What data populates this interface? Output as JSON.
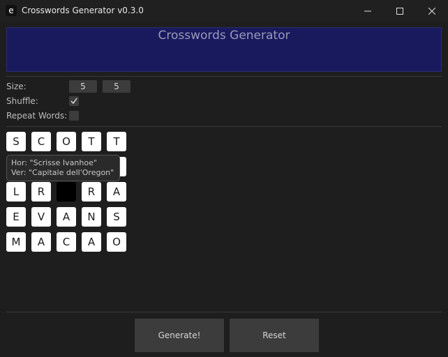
{
  "window": {
    "title": "Crosswords Generator v0.3.0",
    "app_icon_letter": "e"
  },
  "header": {
    "title": "Crosswords Generator",
    "bg_color": "#191a5e"
  },
  "settings": {
    "size_label": "Size:",
    "size_rows": "5",
    "size_cols": "5",
    "shuffle_label": "Shuffle:",
    "shuffle_checked": true,
    "repeat_label": "Repeat Words:",
    "repeat_checked": false
  },
  "grid": [
    [
      "S",
      "C",
      "O",
      "T",
      "T"
    ],
    [
      "",
      "",
      "",
      "",
      ""
    ],
    [
      "L",
      "R",
      "#",
      "R",
      "A"
    ],
    [
      "E",
      "V",
      "A",
      "N",
      "S"
    ],
    [
      "M",
      "A",
      "C",
      "A",
      "O"
    ]
  ],
  "tooltip": {
    "hor": "Hor: \"Scrisse Ivanhoe\"",
    "ver": "Ver: \"Capitale dell'Oregon\""
  },
  "buttons": {
    "generate": "Generate!",
    "reset": "Reset"
  }
}
